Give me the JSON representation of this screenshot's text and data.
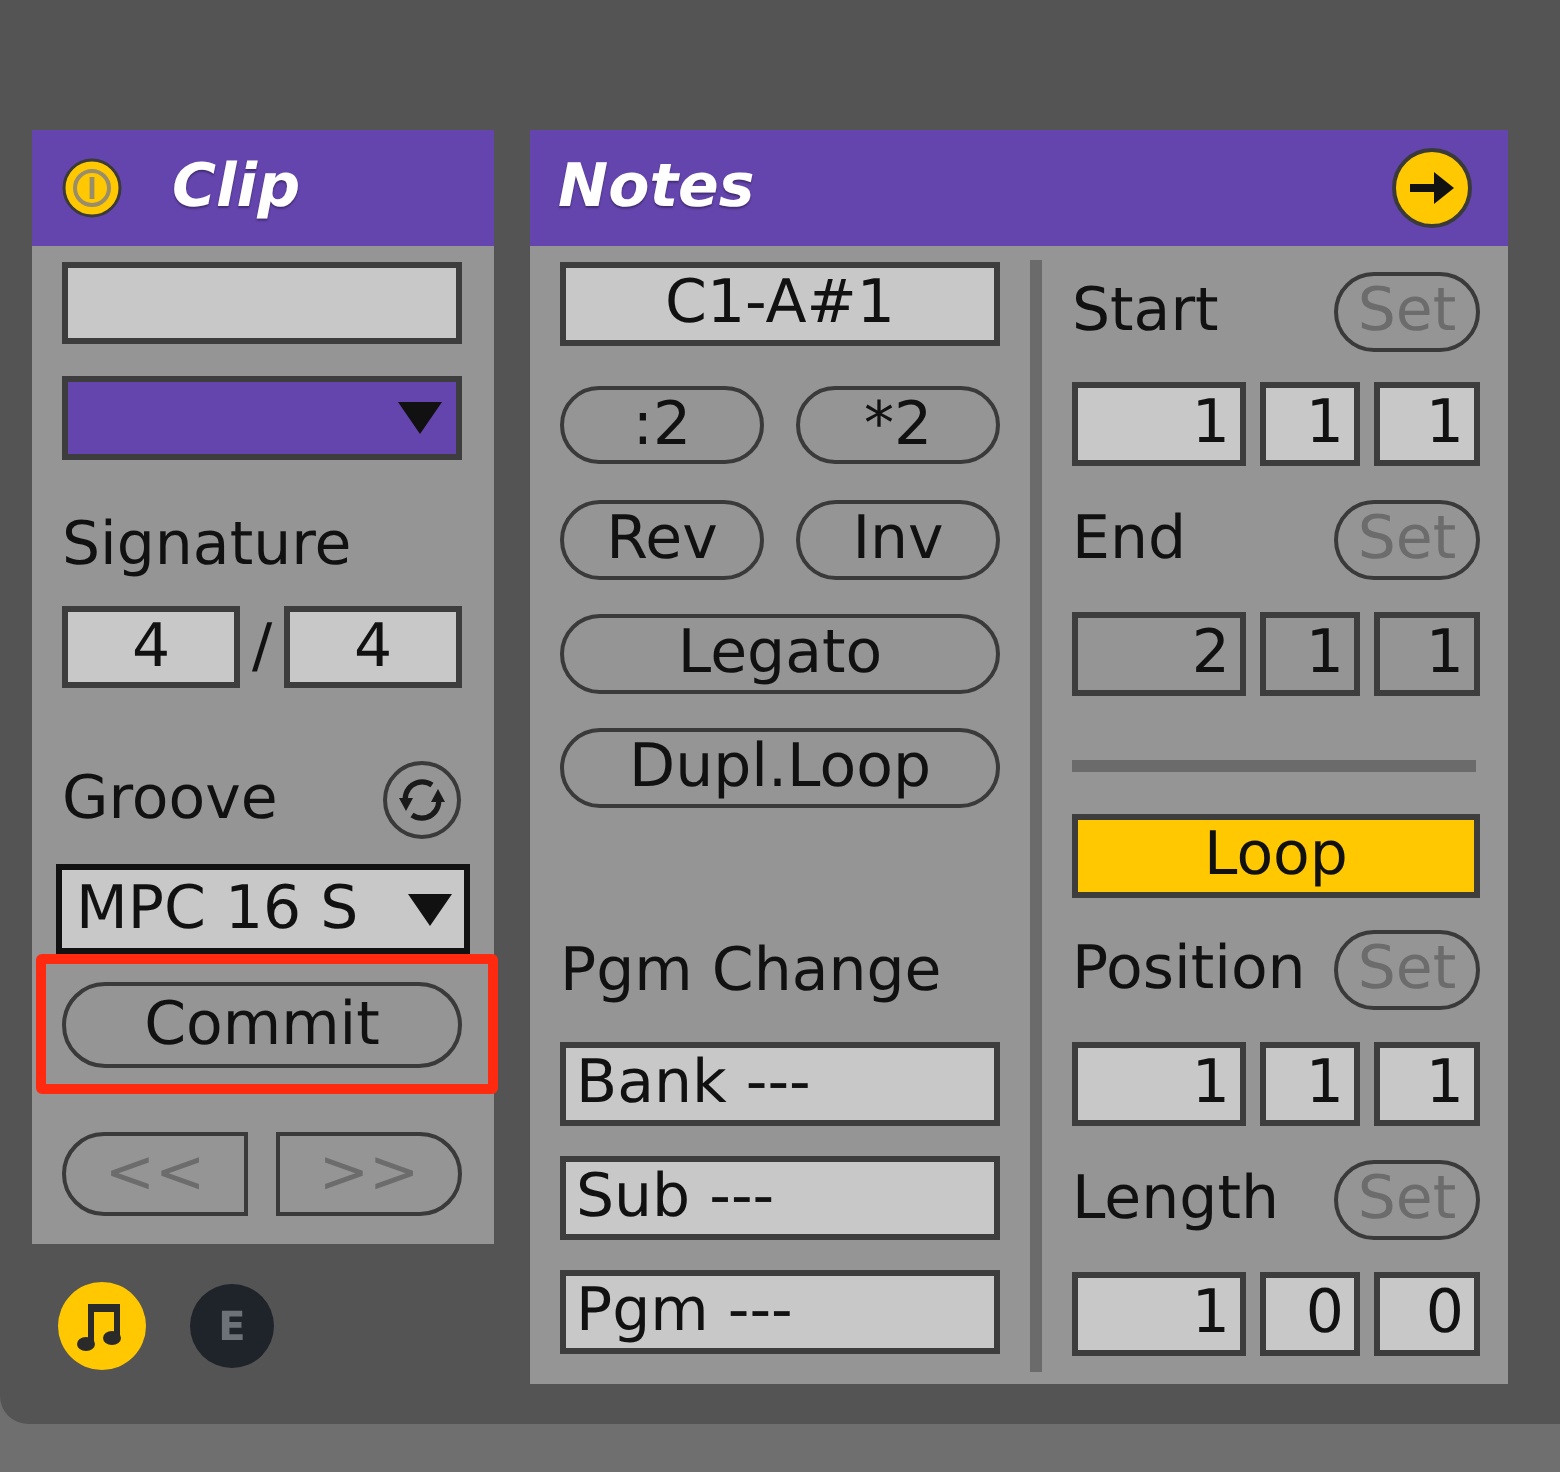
{
  "clip": {
    "title": "Clip",
    "active": true,
    "signature": {
      "label": "Signature",
      "numerator": "4",
      "separator": "/",
      "denominator": "4"
    },
    "groove": {
      "label": "Groove",
      "value": "MPC 16 S"
    },
    "commit": {
      "label": "Commit",
      "highlighted": true
    },
    "nudge": [
      {
        "label": "<<",
        "disabled": true
      },
      {
        "label": ">>",
        "disabled": true
      }
    ]
  },
  "view_toggles": [
    {
      "kind": "note",
      "selected": true
    },
    {
      "kind": "letter",
      "label": "E",
      "selected": false
    }
  ],
  "notes": {
    "title": "Notes",
    "pitch_range": "C1-A#1",
    "button_rows": [
      [
        ":2",
        "*2"
      ],
      [
        "Rev",
        "Inv"
      ],
      [
        "Legato"
      ],
      [
        "Dupl.Loop"
      ]
    ],
    "pgm_change": {
      "label": "Pgm Change",
      "fields": [
        "Bank ---",
        "Sub ---",
        "Pgm ---"
      ]
    },
    "markers": [
      {
        "label": "Start",
        "set": {
          "label": "Set",
          "disabled": true
        },
        "values": [
          "1",
          "1",
          "1"
        ],
        "active": true
      },
      {
        "label": "End",
        "set": {
          "label": "Set",
          "disabled": true
        },
        "values": [
          "2",
          "1",
          "1"
        ],
        "active": false
      }
    ],
    "loop": {
      "label": "Loop",
      "on": true
    },
    "loop_markers": [
      {
        "label": "Position",
        "set": {
          "label": "Set",
          "disabled": true
        },
        "values": [
          "1",
          "1",
          "1"
        ],
        "active": true
      },
      {
        "label": "Length",
        "set": {
          "label": "Set",
          "disabled": true
        },
        "values": [
          "1",
          "0",
          "0"
        ],
        "active": true
      }
    ]
  }
}
